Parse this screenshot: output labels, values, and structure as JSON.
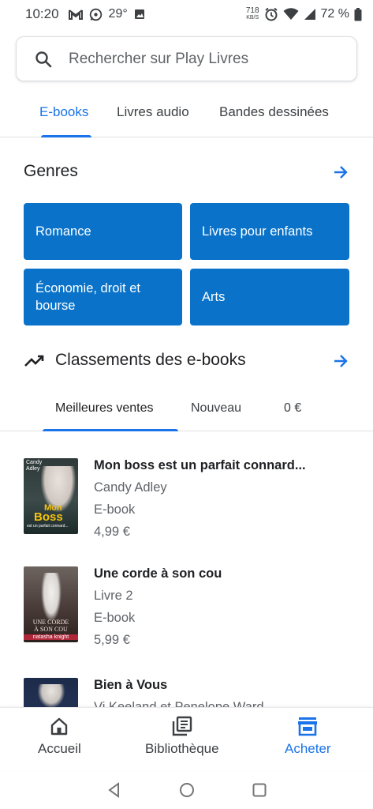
{
  "status": {
    "time": "10:20",
    "temperature": "29°",
    "netspeed_value": "718",
    "netspeed_unit": "KB/S",
    "battery": "72 %"
  },
  "search": {
    "placeholder": "Rechercher sur Play Livres"
  },
  "top_tabs": [
    {
      "label": "E-books",
      "active": true
    },
    {
      "label": "Livres audio",
      "active": false
    },
    {
      "label": "Bandes dessinées",
      "active": false
    }
  ],
  "genres": {
    "title": "Genres",
    "items": [
      "Romance",
      "Livres pour enfants",
      "Économie, droit et bourse",
      "Arts"
    ]
  },
  "rankings": {
    "title": "Classements des e-books",
    "tabs": [
      {
        "label": "Meilleures ventes",
        "active": true
      },
      {
        "label": "Nouveau",
        "active": false
      },
      {
        "label": "0 €",
        "active": false
      }
    ]
  },
  "books": [
    {
      "title": "Mon boss est un parfait connard...",
      "line1": "Candy Adley",
      "line2": "E-book",
      "price": "4,99 €",
      "cover_author": "Candy Adley",
      "cover_title_1": "Mon",
      "cover_title_2": "Boss",
      "cover_subtitle": "est un parfait connard..."
    },
    {
      "title": "Une corde à son cou",
      "line1": "Livre 2",
      "line2": "E-book",
      "price": "5,99 €",
      "cover_title_1": "UNE CORDE",
      "cover_title_2": "À SON COU",
      "cover_author": "natasha knight"
    },
    {
      "title": "Bien à Vous",
      "line1": "Vi Keeland et Penelope Ward",
      "line2": "",
      "price": ""
    }
  ],
  "bottom_nav": [
    {
      "label": "Accueil",
      "icon": "home-icon",
      "active": false
    },
    {
      "label": "Bibliothèque",
      "icon": "library-icon",
      "active": false
    },
    {
      "label": "Acheter",
      "icon": "store-icon",
      "active": true
    }
  ],
  "colors": {
    "accent": "#1a73e8",
    "genre_button": "#0a73c9",
    "text_primary": "#202124",
    "text_secondary": "#5f6368"
  }
}
